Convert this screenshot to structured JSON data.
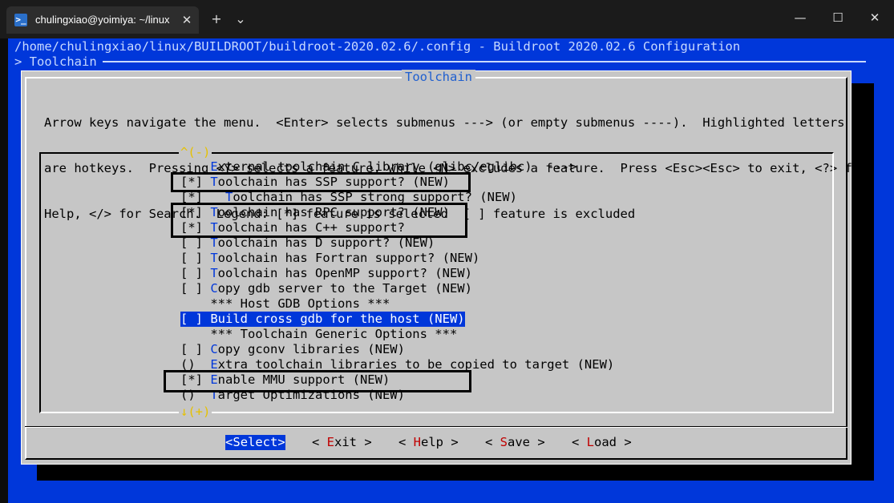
{
  "window": {
    "tab_icon": ">_",
    "tab_title": "chulingxiao@yoimiya: ~/linux",
    "tab_close": "✕",
    "new_tab": "+",
    "dropdown": "⌄",
    "minimize": "—",
    "maximize": "☐",
    "close": "✕"
  },
  "terminal": {
    "path_line": "/home/chulingxiao/linux/BUILDROOT/buildroot-2020.02.6/.config - Buildroot 2020.02.6 Configuration",
    "breadcrumb": "> Toolchain"
  },
  "dialog": {
    "title": "Toolchain",
    "help_lines": [
      "Arrow keys navigate the menu.  <Enter> selects submenus ---> (or empty submenus ----).  Highlighted letters",
      "are hotkeys.  Pressing <Y> selects a feature, while <N> excludes a feature.  Press <Esc><Esc> to exit, <?> for",
      "Help, </> for Search.  Legend: [*] feature is selected  [ ] feature is excluded"
    ],
    "scroll_up": "^(-)",
    "scroll_down": "↓(+)"
  },
  "menu": {
    "items": [
      {
        "prefix": "    ",
        "hotkey": "E",
        "rest": "xternal toolchain C library (glibc/eglibc)  --->",
        "selected": false
      },
      {
        "prefix": "[*] ",
        "hotkey": "T",
        "rest": "oolchain has SSP support? (NEW)",
        "selected": false
      },
      {
        "prefix": "[*]   ",
        "hotkey": "T",
        "rest": "oolchain has SSP strong support? (NEW)",
        "selected": false
      },
      {
        "prefix": "[*] ",
        "hotkey": "T",
        "rest": "oolchain has RPC support? (NEW)",
        "selected": false
      },
      {
        "prefix": "[*] ",
        "hotkey": "T",
        "rest": "oolchain has C++ support?",
        "selected": false
      },
      {
        "prefix": "[ ] ",
        "hotkey": "T",
        "rest": "oolchain has D support? (NEW)",
        "selected": false
      },
      {
        "prefix": "[ ] ",
        "hotkey": "T",
        "rest": "oolchain has Fortran support? (NEW)",
        "selected": false
      },
      {
        "prefix": "[ ] ",
        "hotkey": "T",
        "rest": "oolchain has OpenMP support? (NEW)",
        "selected": false
      },
      {
        "prefix": "[ ] ",
        "hotkey": "C",
        "rest": "opy gdb server to the Target (NEW)",
        "selected": false
      },
      {
        "prefix": "    ",
        "hotkey": "",
        "rest": "*** Host GDB Options ***",
        "selected": false
      },
      {
        "prefix": "[ ] ",
        "hotkey": "B",
        "rest": "uild cross gdb for the host (NEW)",
        "selected": true
      },
      {
        "prefix": "    ",
        "hotkey": "",
        "rest": "*** Toolchain Generic Options ***",
        "selected": false
      },
      {
        "prefix": "[ ] ",
        "hotkey": "C",
        "rest": "opy gconv libraries (NEW)",
        "selected": false
      },
      {
        "prefix": "()  ",
        "hotkey": "E",
        "rest": "xtra toolchain libraries to be copied to target (NEW)",
        "selected": false
      },
      {
        "prefix": "[*] ",
        "hotkey": "E",
        "rest": "nable MMU support (NEW)",
        "selected": false
      },
      {
        "prefix": "()  ",
        "hotkey": "T",
        "rest": "arget Optimizations (NEW)",
        "selected": false
      }
    ]
  },
  "buttons": [
    {
      "open": "<",
      "hotkey": "S",
      "rest": "elect",
      "close": ">",
      "selected": true
    },
    {
      "open": "< ",
      "hotkey": "E",
      "rest": "xit",
      "close": " >",
      "selected": false
    },
    {
      "open": "< ",
      "hotkey": "H",
      "rest": "elp",
      "close": " >",
      "selected": false
    },
    {
      "open": "< ",
      "hotkey": "S",
      "rest": "ave",
      "close": " >",
      "selected": false
    },
    {
      "open": "< ",
      "hotkey": "L",
      "rest": "oad",
      "close": " >",
      "selected": false
    }
  ]
}
